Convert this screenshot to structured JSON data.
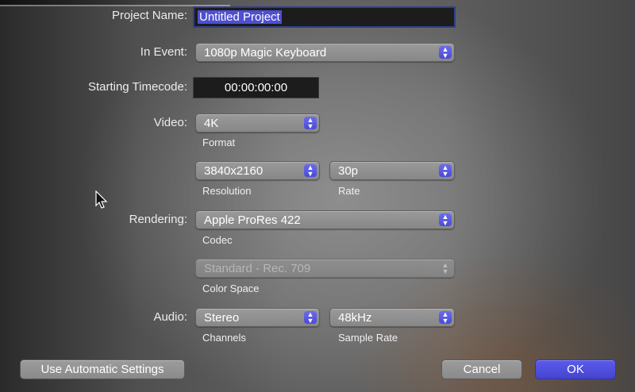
{
  "project_name": {
    "label": "Project Name:",
    "value": "Untitled Project"
  },
  "in_event": {
    "label": "In Event:",
    "value": "1080p Magic Keyboard"
  },
  "starting_timecode": {
    "label": "Starting Timecode:",
    "value": "00:00:00:00"
  },
  "video": {
    "label": "Video:",
    "format": {
      "value": "4K",
      "caption": "Format"
    },
    "resolution": {
      "value": "3840x2160",
      "caption": "Resolution"
    },
    "rate": {
      "value": "30p",
      "caption": "Rate"
    }
  },
  "rendering": {
    "label": "Rendering:",
    "codec": {
      "value": "Apple ProRes 422",
      "caption": "Codec"
    },
    "color_space": {
      "value": "Standard - Rec. 709",
      "caption": "Color Space",
      "enabled": false
    }
  },
  "audio": {
    "label": "Audio:",
    "channels": {
      "value": "Stereo",
      "caption": "Channels"
    },
    "sample_rate": {
      "value": "48kHz",
      "caption": "Sample Rate"
    }
  },
  "buttons": {
    "use_automatic": "Use Automatic Settings",
    "cancel": "Cancel",
    "ok": "OK"
  },
  "colors": {
    "accent": "#5050e0",
    "selection": "#4f4fd0"
  }
}
